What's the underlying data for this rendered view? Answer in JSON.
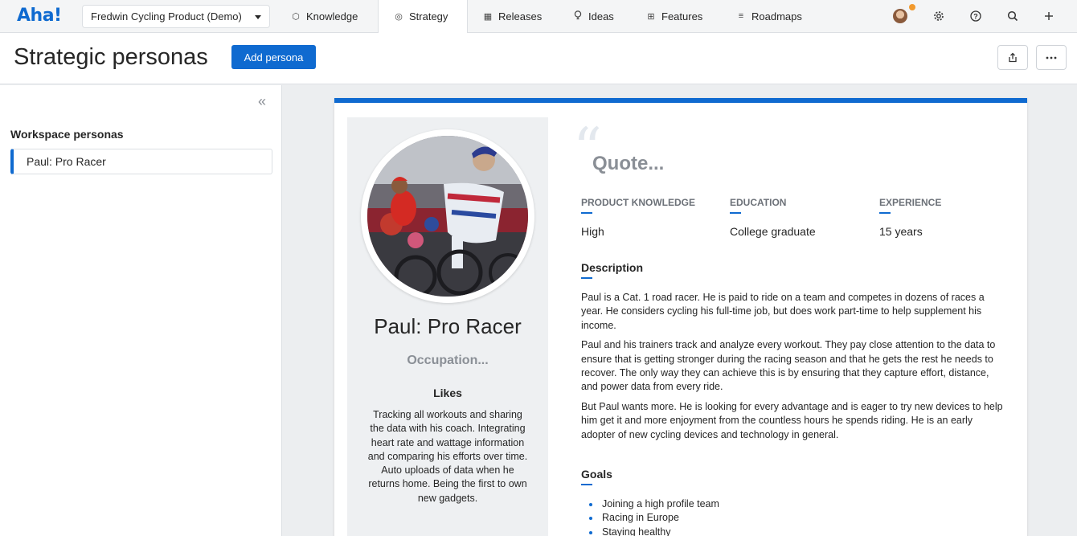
{
  "app": {
    "logo": "Aha!",
    "workspace": "Fredwin Cycling Product (Demo)"
  },
  "nav": {
    "tabs": [
      {
        "label": "Knowledge",
        "icon": "knowledge-icon"
      },
      {
        "label": "Strategy",
        "icon": "target-icon",
        "active": true
      },
      {
        "label": "Releases",
        "icon": "calendar-icon"
      },
      {
        "label": "Ideas",
        "icon": "lightbulb-icon"
      },
      {
        "label": "Features",
        "icon": "grid-icon"
      },
      {
        "label": "Roadmaps",
        "icon": "roadmap-icon"
      }
    ],
    "right_icons": [
      "avatar",
      "settings-icon",
      "help-icon",
      "search-icon",
      "add-icon"
    ]
  },
  "header": {
    "title": "Strategic personas",
    "add_button": "Add persona"
  },
  "sidebar": {
    "heading": "Workspace personas",
    "items": [
      {
        "label": "Paul: Pro Racer",
        "selected": true
      }
    ]
  },
  "persona": {
    "name": "Paul: Pro Racer",
    "occupation_placeholder": "Occupation...",
    "quote_placeholder": "Quote...",
    "likes_heading": "Likes",
    "likes_text": "Tracking all workouts and sharing the data with his coach. Integrating heart rate and wattage information and comparing his efforts over time. Auto uploads of data when he returns home. Being the first to own new gadgets.",
    "stats": [
      {
        "label": "PRODUCT KNOWLEDGE",
        "value": "High"
      },
      {
        "label": "EDUCATION",
        "value": "College graduate"
      },
      {
        "label": "EXPERIENCE",
        "value": "15 years"
      }
    ],
    "description_heading": "Description",
    "description": [
      "Paul is a Cat. 1 road racer. He is paid to ride on a team and competes in dozens of races a year. He considers cycling his full-time job, but does work part-time to help supplement his income.",
      "Paul and his trainers track and analyze every workout. They pay close attention to the data to ensure that is getting stronger during the racing season and that he gets the rest he needs to recover. The only way they can achieve this is by ensuring that they capture effort, distance, and power data from every ride.",
      "But Paul wants more. He is looking for every advantage and is eager to try new devices to help him get it and more enjoyment from the countless hours he spends riding. He is an early adopter of new cycling devices and technology in general."
    ],
    "goals_heading": "Goals",
    "goals": [
      "Joining a high profile team",
      "Racing in Europe",
      "Staying healthy"
    ]
  },
  "colors": {
    "accent": "#0f6ad0",
    "muted": "#8a8f96",
    "panel": "#eef0f2"
  }
}
